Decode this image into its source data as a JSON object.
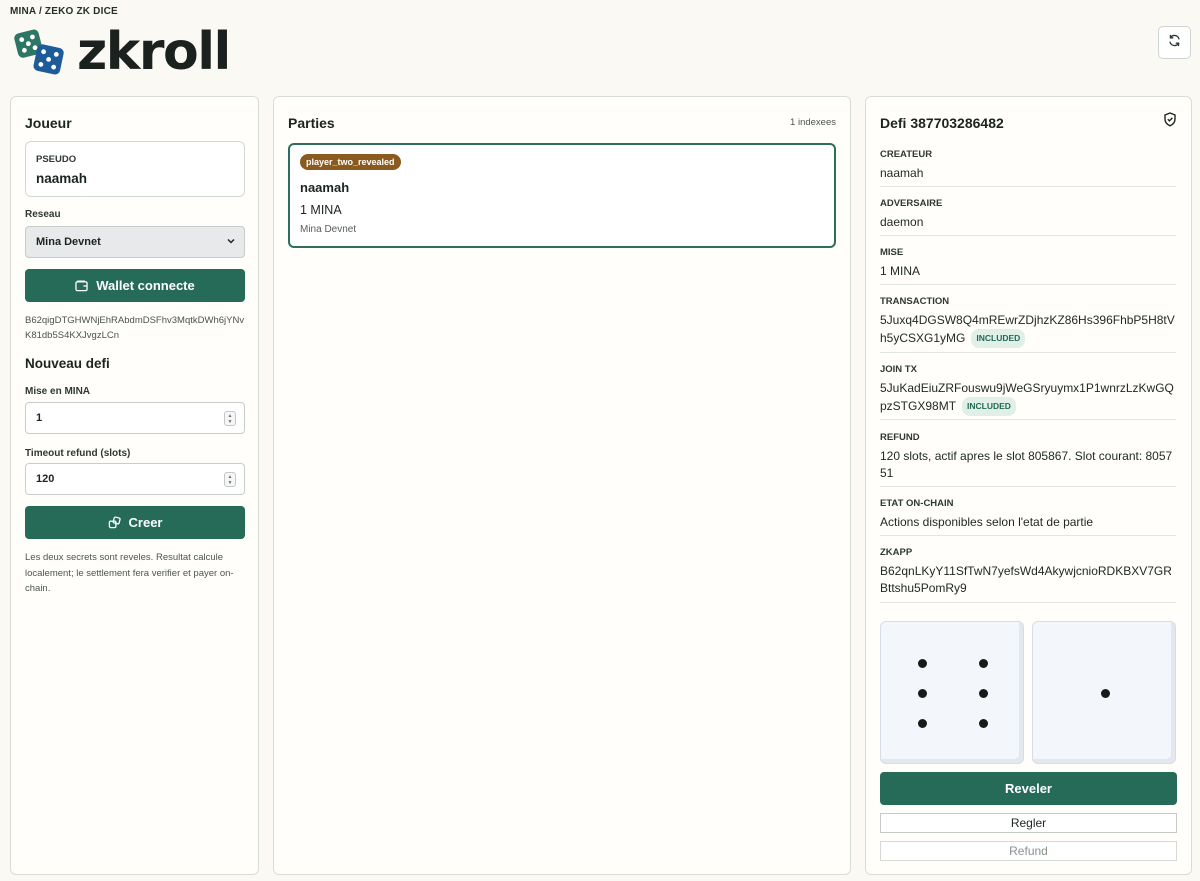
{
  "breadcrumb": "MINA / ZEKO ZK DICE",
  "app_title": "zkroll",
  "player": {
    "title": "Joueur",
    "pseudo_label": "PSEUDO",
    "pseudo_value": "naamah",
    "network_label": "Reseau",
    "network_value": "Mina Devnet",
    "wallet_button": "Wallet connecte",
    "wallet_address": "B62qigDTGHWNjEhRAbdmDSFhv3MqtkDWh6jYNvK81db5S4KXJvgzLCn"
  },
  "new_challenge": {
    "title": "Nouveau defi",
    "stake_label": "Mise en MINA",
    "stake_value": "1",
    "timeout_label": "Timeout refund (slots)",
    "timeout_value": "120",
    "create_button": "Creer",
    "note": "Les deux secrets sont reveles. Resultat calcule localement; le settlement fera verifier et payer on-chain."
  },
  "games": {
    "title": "Parties",
    "count": "1 indexees",
    "items": [
      {
        "status": "player_two_revealed",
        "name": "naamah",
        "stake": "1 MINA",
        "network": "Mina Devnet"
      }
    ]
  },
  "challenge": {
    "title": "Defi 387703286482",
    "creator_label": "CREATEUR",
    "creator": "naamah",
    "opponent_label": "ADVERSAIRE",
    "opponent": "daemon",
    "stake_label": "MISE",
    "stake": "1 MINA",
    "tx_label": "TRANSACTION",
    "tx": "5Juxq4DGSW8Q4mREwrZDjhzKZ86Hs396FhbP5H8tVh5yCSXG1yMG",
    "tx_status": "INCLUDED",
    "join_label": "JOIN TX",
    "join_tx": "5JuKadEiuZRFouswu9jWeGSryuymx1P1wnrzLzKwGQpzSTGX98MT",
    "join_status": "INCLUDED",
    "refund_label": "REFUND",
    "refund": "120 slots, actif apres le slot 805867. Slot courant: 805751",
    "state_label": "ETAT ON-CHAIN",
    "state": "Actions disponibles selon l'etat de partie",
    "zkapp_label": "ZKAPP",
    "zkapp": "B62qnLKyY11SfTwN7yefsWd4AkywjcnioRDKBXV7GRBttshu5PomRy9",
    "dice": [
      6,
      1
    ],
    "reveal_button": "Reveler",
    "settle_button": "Regler",
    "refund_button": "Refund"
  },
  "colors": {
    "primary": "#266a58",
    "badge": "#8b5a1e",
    "background": "#faf9f4"
  },
  "icons": [
    "dice-logo-icon",
    "refresh-icon",
    "wallet-icon",
    "create-icon",
    "chevron-down-icon",
    "shield-icon"
  ]
}
